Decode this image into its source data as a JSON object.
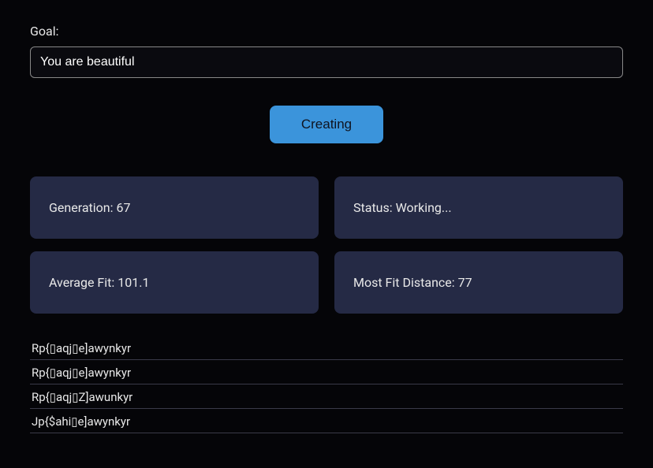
{
  "goal": {
    "label": "Goal:",
    "value": "You are beautiful"
  },
  "button": {
    "create_label": "Creating"
  },
  "stats": {
    "generation_label": "Generation: 67",
    "status_label": "Status: Working...",
    "avg_fit_label": "Average Fit: 101.1",
    "most_fit_label": "Most Fit Distance: 77"
  },
  "population": [
    "Rp{▯aqj▯e]awynkyr",
    "Rp{▯aqj▯e]awynkyr",
    "Rp{▯aqj▯Z]awunkyr",
    "Jp{$ahi▯e]awynkyr"
  ]
}
